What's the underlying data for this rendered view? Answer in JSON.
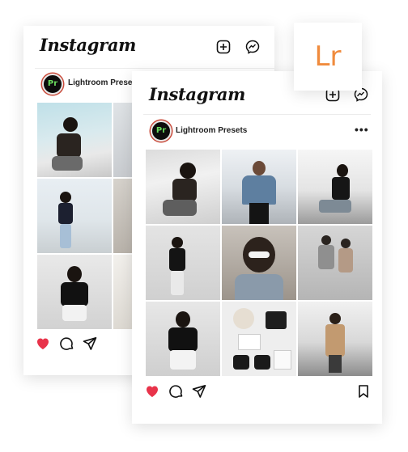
{
  "app": {
    "logo_text": "Instagram"
  },
  "back_post": {
    "account_name": "Lightroom Presets",
    "avatar_text": "Pr"
  },
  "front_post": {
    "account_name": "Lightroom Presets",
    "avatar_text": "Pr",
    "more_label": "•••"
  },
  "lightroom_badge": {
    "text": "Lr",
    "color": "#f08b3d"
  },
  "colors": {
    "like_red": "#e8334a",
    "preset_accent": "#6bdc5e"
  },
  "icons": [
    "add-post-icon",
    "messenger-icon",
    "heart-icon",
    "comment-icon",
    "share-icon",
    "bookmark-icon"
  ]
}
